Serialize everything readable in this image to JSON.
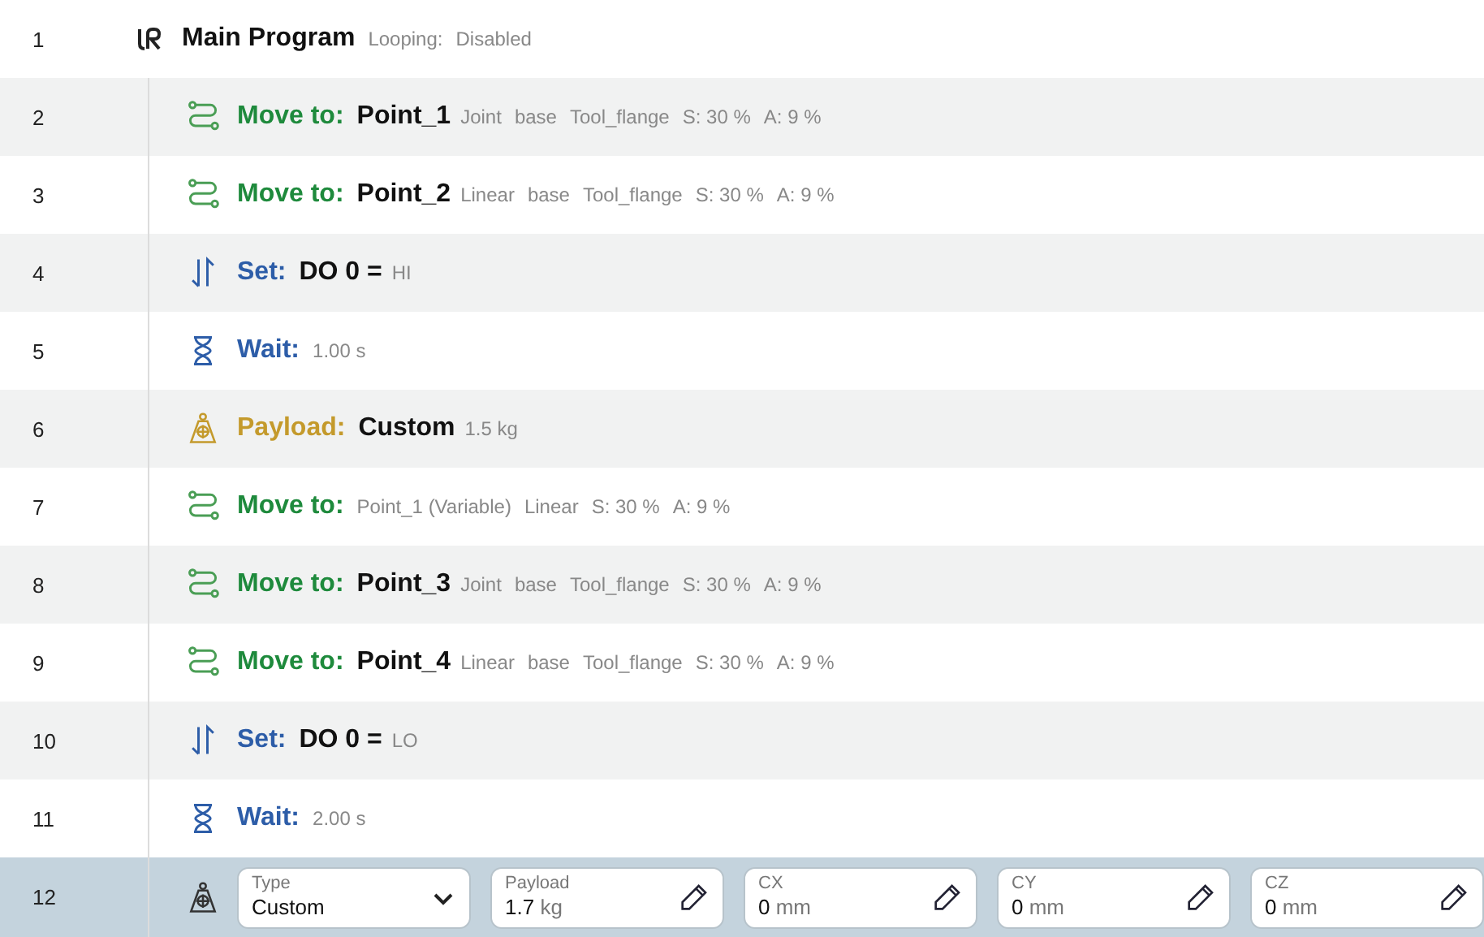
{
  "rows": [
    {
      "number": "1",
      "kind": "program",
      "selected": false,
      "title": "Main Program",
      "details": [
        "Looping:",
        "Disabled"
      ]
    },
    {
      "number": "2",
      "kind": "move",
      "selected": false,
      "label": "Move to:",
      "target": "Point_1",
      "details": [
        "Joint",
        "base",
        "Tool_flange",
        "S: 30 %",
        "A: 9 %"
      ]
    },
    {
      "number": "3",
      "kind": "move",
      "selected": false,
      "label": "Move to:",
      "target": "Point_2",
      "details": [
        "Linear",
        "base",
        "Tool_flange",
        "S: 30 %",
        "A: 9 %"
      ]
    },
    {
      "number": "4",
      "kind": "set",
      "selected": false,
      "label": "Set:",
      "target": "DO 0 =",
      "details": [
        "HI"
      ]
    },
    {
      "number": "5",
      "kind": "wait",
      "selected": false,
      "label": "Wait:",
      "details": [
        "1.00 s"
      ]
    },
    {
      "number": "6",
      "kind": "payload",
      "selected": false,
      "label": "Payload:",
      "target": "Custom",
      "details": [
        "1.5 kg"
      ]
    },
    {
      "number": "7",
      "kind": "move",
      "selected": false,
      "label": "Move to:",
      "details": [
        "Point_1 (Variable)",
        "Linear",
        "S: 30 %",
        "A: 9 %"
      ]
    },
    {
      "number": "8",
      "kind": "move",
      "selected": false,
      "label": "Move to:",
      "target": "Point_3",
      "details": [
        "Joint",
        "base",
        "Tool_flange",
        "S: 30 %",
        "A: 9 %"
      ]
    },
    {
      "number": "9",
      "kind": "move",
      "selected": false,
      "label": "Move to:",
      "target": "Point_4",
      "details": [
        "Linear",
        "base",
        "Tool_flange",
        "S: 30 %",
        "A: 9 %"
      ]
    },
    {
      "number": "10",
      "kind": "set",
      "selected": false,
      "label": "Set:",
      "target": "DO 0 =",
      "details": [
        "LO"
      ]
    },
    {
      "number": "11",
      "kind": "wait",
      "selected": false,
      "label": "Wait:",
      "details": [
        "2.00 s"
      ]
    },
    {
      "number": "12",
      "kind": "payload_edit",
      "selected": true,
      "fields": [
        {
          "kind": "dropdown",
          "label": "Type",
          "value": "Custom"
        },
        {
          "kind": "edit",
          "label": "Payload",
          "value": "1.7",
          "unit": "kg"
        },
        {
          "kind": "edit",
          "label": "CX",
          "value": "0",
          "unit": "mm"
        },
        {
          "kind": "edit",
          "label": "CY",
          "value": "0",
          "unit": "mm"
        },
        {
          "kind": "edit",
          "label": "CZ",
          "value": "0",
          "unit": "mm"
        }
      ]
    }
  ]
}
